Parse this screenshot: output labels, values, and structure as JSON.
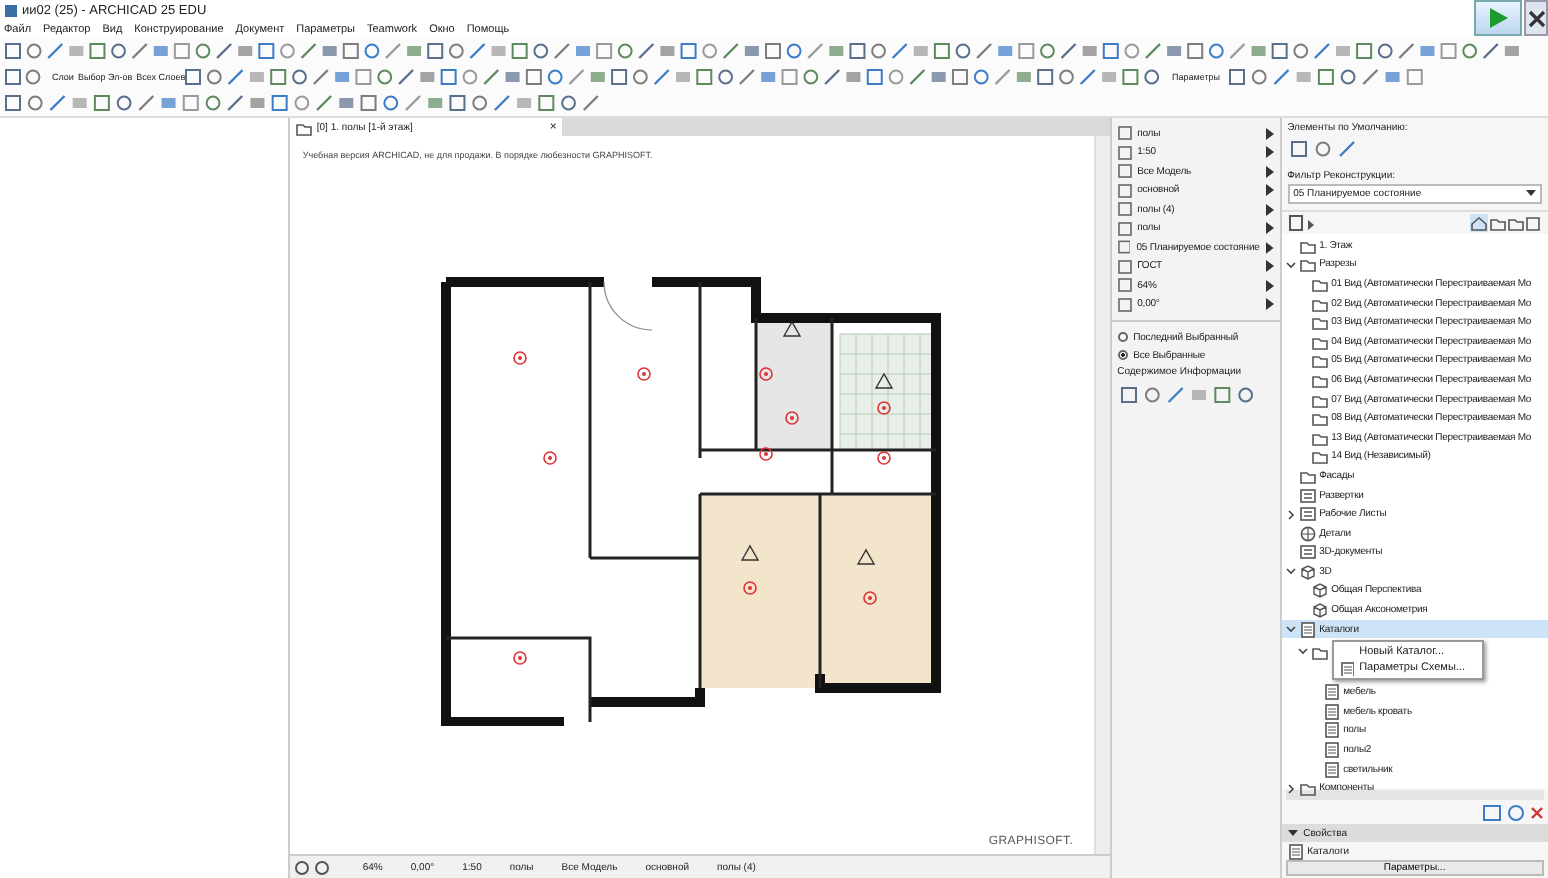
{
  "window": {
    "title": "ии02 (25) - ARCHICAD 25 EDU"
  },
  "menu": [
    "Файл",
    "Редактор",
    "Вид",
    "Конструирование",
    "Документ",
    "Параметры",
    "Teamwork",
    "Окно",
    "Помощь"
  ],
  "toolbar": {
    "layer_labels": [
      "Слои",
      "Выбор Эл-ов",
      "Всех Слоев"
    ],
    "params_label": "Параметры"
  },
  "view_tab": {
    "label": "[0] 1. полы [1-й этаж]",
    "close": "×"
  },
  "canvas": {
    "notice": "Учебная версия ARCHICAD, не для продажи. В порядке любезности GRAPHISOFT.",
    "brand": "GRAPHISOFT."
  },
  "status_bar": [
    "64%",
    "0,00°",
    "1:50",
    "полы",
    "Все Модель",
    "основной",
    "полы (4)"
  ],
  "quick_options": [
    {
      "label": "полы"
    },
    {
      "label": "1:50"
    },
    {
      "label": "Все Модель"
    },
    {
      "label": "основной"
    },
    {
      "label": "полы (4)"
    },
    {
      "label": "полы"
    },
    {
      "label": "05 Планируемое состояние"
    },
    {
      "label": "ГОСТ"
    },
    {
      "label": "64%"
    },
    {
      "label": "0,00°"
    }
  ],
  "selection": {
    "options": [
      {
        "label": "Последний Выбранный",
        "selected": false
      },
      {
        "label": "Все Выбранные",
        "selected": true
      }
    ],
    "heading": "Содержимое Информации"
  },
  "defaults": {
    "label": "Элементы по Умолчанию:"
  },
  "renovation": {
    "label": "Фильтр Реконструкции:",
    "value": "05 Планируемое состояние"
  },
  "navigator": [
    {
      "label": "1. Этаж",
      "kind": "folder",
      "selected": false
    },
    {
      "label": "Разрезы",
      "kind": "folder",
      "expanded": true,
      "selected": false,
      "children": [
        {
          "label": "01 Вид (Автоматически Перестраиваемая Мо",
          "kind": "folder",
          "selected": false
        },
        {
          "label": "02 Вид (Автоматически Перестраиваемая Мо",
          "kind": "folder",
          "selected": false
        },
        {
          "label": "03 Вид (Автоматически Перестраиваемая Мо",
          "kind": "folder",
          "selected": false
        },
        {
          "label": "04 Вид (Автоматически Перестраиваемая Мо",
          "kind": "folder",
          "selected": false
        },
        {
          "label": "05 Вид (Автоматически Перестраиваемая Мо",
          "kind": "folder",
          "selected": false
        },
        {
          "label": "06 Вид (Автоматически Перестраиваемая Мо",
          "kind": "folder",
          "selected": false
        },
        {
          "label": "07 Вид (Автоматически Перестраиваемая Мо",
          "kind": "folder",
          "selected": false
        },
        {
          "label": "08 Вид (Автоматически Перестраиваемая Мо",
          "kind": "folder",
          "selected": false
        },
        {
          "label": "13 Вид (Автоматически Перестраиваемая Мо",
          "kind": "folder",
          "selected": false
        },
        {
          "label": "14 Вид (Независимый)",
          "kind": "folder",
          "selected": false
        }
      ]
    },
    {
      "label": "Фасады",
      "kind": "folder",
      "selected": false
    },
    {
      "label": "Развертки",
      "kind": "sheet",
      "selected": false
    },
    {
      "label": "Рабочие Листы",
      "kind": "sheet",
      "expanded": false,
      "selected": false
    },
    {
      "label": "Детали",
      "kind": "globe",
      "selected": false
    },
    {
      "label": "3D-документы",
      "kind": "sheet",
      "selected": false
    },
    {
      "label": "3D",
      "kind": "cube",
      "expanded": true,
      "selected": false,
      "children": [
        {
          "label": "Общая Перспектива",
          "kind": "cube",
          "selected": false
        },
        {
          "label": "Общая Аксонометрия",
          "kind": "cube",
          "selected": false
        }
      ]
    },
    {
      "label": "Каталоги",
      "kind": "list",
      "expanded": true,
      "selected": true,
      "children": [
        {
          "kind": "folder",
          "expanded": true,
          "selected": false,
          "children": [
            {
              "label": "мебель",
              "kind": "list",
              "selected": false
            },
            {
              "label": "мебель кровать",
              "kind": "list",
              "selected": false
            },
            {
              "label": "полы",
              "kind": "list",
              "selected": false
            },
            {
              "label": "полы2",
              "kind": "list",
              "selected": false
            },
            {
              "label": "светильник",
              "kind": "list",
              "selected": false
            }
          ]
        }
      ]
    },
    {
      "label": "Компоненты",
      "kind": "folder",
      "expanded": false,
      "selected": false
    }
  ],
  "context_menu": [
    "Новый Каталог...",
    "Параметры Схемы..."
  ],
  "properties": {
    "title": "Свойства",
    "item": "Каталоги",
    "button": "Параметры..."
  }
}
